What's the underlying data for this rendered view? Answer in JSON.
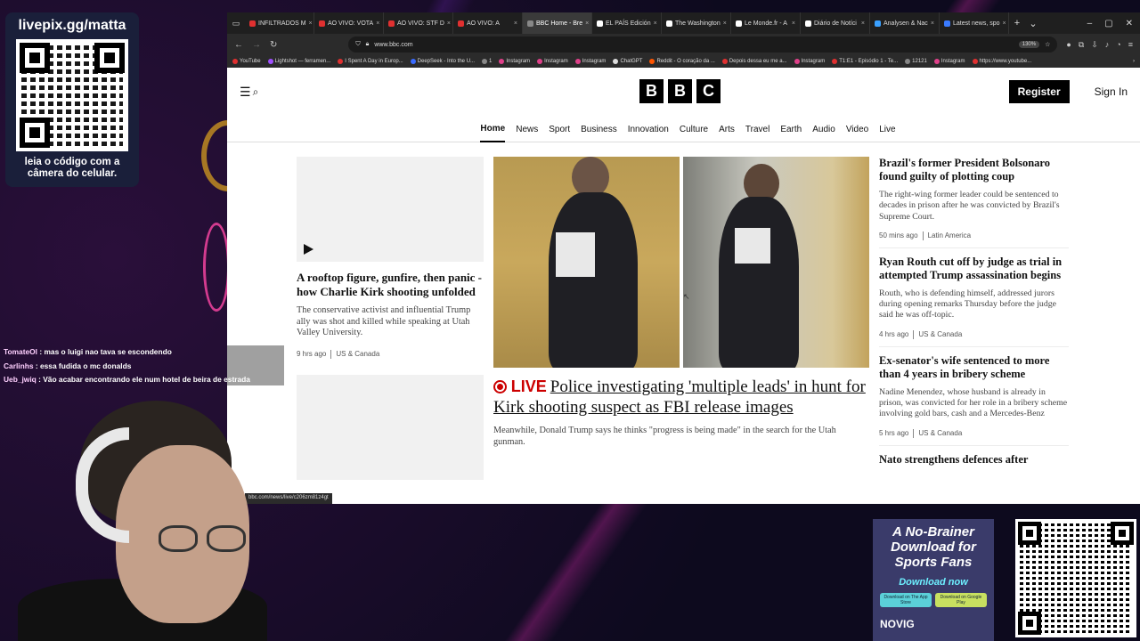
{
  "overlay": {
    "title": "livepix.gg/matta",
    "caption": "leia o código com a câmera do celular."
  },
  "browser": {
    "tabs": [
      {
        "label": "INFILTRADOS M",
        "color": "#e03030"
      },
      {
        "label": "AO VIVO: VOTA",
        "color": "#e03030"
      },
      {
        "label": "AO VIVO: STF D",
        "color": "#e03030"
      },
      {
        "label": "AO VIVO: A",
        "color": "#e03030"
      },
      {
        "label": "BBC Home - Bre",
        "color": "#888888",
        "active": true
      },
      {
        "label": "EL PAÍS Edición",
        "color": "#ffffff"
      },
      {
        "label": "The Washington",
        "color": "#ffffff"
      },
      {
        "label": "Le Monde.fr - A",
        "color": "#ffffff"
      },
      {
        "label": "Diário de Notíci",
        "color": "#ffffff"
      },
      {
        "label": "Analysen & Nac",
        "color": "#3aa0ff"
      },
      {
        "label": "Latest news, spo",
        "color": "#3a7bff"
      }
    ],
    "url": "www.bbc.com",
    "zoom": "130%",
    "bookmarks": [
      {
        "label": "YouTube",
        "color": "#e03030"
      },
      {
        "label": "Lightshot — ferramen...",
        "color": "#a050ff"
      },
      {
        "label": "I Spent A Day in Europ...",
        "color": "#e03030"
      },
      {
        "label": "DeepSeek - Into the U...",
        "color": "#3a6bff"
      },
      {
        "label": "1",
        "color": "#888888"
      },
      {
        "label": "Instagram",
        "color": "#e0408a"
      },
      {
        "label": "Instagram",
        "color": "#e0408a"
      },
      {
        "label": "Instagram",
        "color": "#e0408a"
      },
      {
        "label": "ChatGPT",
        "color": "#dddddd"
      },
      {
        "label": "Reddit - O coração da ...",
        "color": "#ff5500"
      },
      {
        "label": "Depois dessa eu me a...",
        "color": "#e03030"
      },
      {
        "label": "Instagram",
        "color": "#e0408a"
      },
      {
        "label": "T1:E1 - Episódio 1 - Te...",
        "color": "#e03030"
      },
      {
        "label": "12121",
        "color": "#888888"
      },
      {
        "label": "Instagram",
        "color": "#e0408a"
      },
      {
        "label": "https://www.youtube...",
        "color": "#e03030"
      }
    ],
    "status_url": "bbc.com/news/live/c206zm81z4gt"
  },
  "bbc": {
    "logo": [
      "B",
      "B",
      "C"
    ],
    "register": "Register",
    "signin": "Sign In",
    "nav": [
      "Home",
      "News",
      "Sport",
      "Business",
      "Innovation",
      "Culture",
      "Arts",
      "Travel",
      "Earth",
      "Audio",
      "Video",
      "Live"
    ],
    "left": {
      "headline": "A rooftop figure, gunfire, then panic - how Charlie Kirk shooting unfolded",
      "summary": "The conservative activist and influential Trump ally was shot and killed while speaking at Utah Valley University.",
      "time": "9 hrs ago",
      "section": "US & Canada"
    },
    "main": {
      "live": "LIVE",
      "headline": "Police investigating 'multiple leads' in hunt for Kirk shooting suspect as FBI release images",
      "summary": "Meanwhile, Donald Trump says he thinks \"progress is being made\" in the search for the Utah gunman."
    },
    "right": [
      {
        "headline": "Brazil's former President Bolsonaro found guilty of plotting coup",
        "summary": "The right-wing former leader could be sentenced to decades in prison after he was convicted by Brazil's Supreme Court.",
        "time": "50 mins ago",
        "section": "Latin America"
      },
      {
        "headline": "Ryan Routh cut off by judge as trial in attempted Trump assassination begins",
        "summary": "Routh, who is defending himself, addressed jurors during opening remarks Thursday before the judge said he was off-topic.",
        "time": "4 hrs ago",
        "section": "US & Canada"
      },
      {
        "headline": "Ex-senator's wife sentenced to more than 4 years in bribery scheme",
        "summary": "Nadine Menendez, whose husband is already in prison, was convicted for her role in a bribery scheme involving gold bars, cash and a Mercedes-Benz",
        "time": "5 hrs ago",
        "section": "US & Canada"
      },
      {
        "headline": "Nato strengthens defences after"
      }
    ]
  },
  "chat": [
    {
      "user": "TomateOl",
      "msg": "mas o luigi nao tava se escondendo"
    },
    {
      "user": "Carlinhs",
      "msg": "essa fudida o mc donalds"
    },
    {
      "user": "Ueb_jwiq",
      "msg": "Vão acabar encontrando ele num hotel de beira de estrada"
    }
  ],
  "ad": {
    "title": "A No-Brainer Download for Sports Fans",
    "cta": "Download now",
    "store1": "Download on The App Store",
    "store2": "Download on Google Play",
    "brand": "NOVIG"
  }
}
